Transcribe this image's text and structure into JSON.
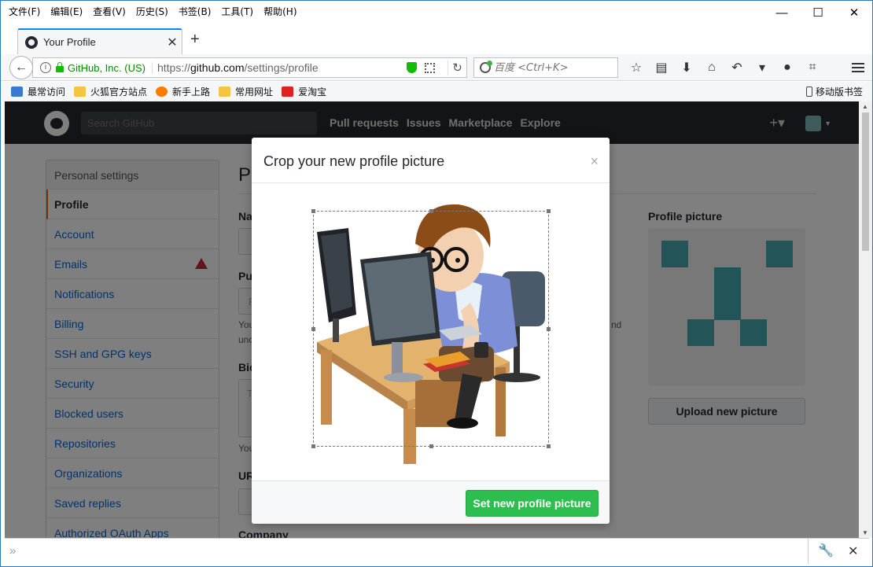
{
  "menubar": {
    "items": [
      "文件(F)",
      "编辑(E)",
      "查看(V)",
      "历史(S)",
      "书签(B)",
      "工具(T)",
      "帮助(H)"
    ]
  },
  "tab": {
    "title": "Your Profile"
  },
  "navbar": {
    "identity": "GitHub, Inc. (US)",
    "url_prefix": "https://",
    "url_domain": "github.com",
    "url_path": "/settings/profile",
    "search_placeholder": "百度 <Ctrl+K>"
  },
  "bookmarks": {
    "items": [
      {
        "label": "最常访问",
        "icon": "most-visited-icon"
      },
      {
        "label": "火狐官方站点",
        "icon": "folder-icon"
      },
      {
        "label": "新手上路",
        "icon": "firefox-icon"
      },
      {
        "label": "常用网址",
        "icon": "folder-icon"
      },
      {
        "label": "爱淘宝",
        "icon": "taobao-icon"
      }
    ],
    "mobile": "移动版书签"
  },
  "github": {
    "search_placeholder": "Search GitHub",
    "nav": [
      "Pull requests",
      "Issues",
      "Marketplace",
      "Explore"
    ]
  },
  "sidebar": {
    "heading": "Personal settings",
    "items": [
      {
        "label": "Profile"
      },
      {
        "label": "Account"
      },
      {
        "label": "Emails"
      },
      {
        "label": "Notifications"
      },
      {
        "label": "Billing"
      },
      {
        "label": "SSH and GPG keys"
      },
      {
        "label": "Security"
      },
      {
        "label": "Blocked users"
      },
      {
        "label": "Repositories"
      },
      {
        "label": "Organizations"
      },
      {
        "label": "Saved replies"
      },
      {
        "label": "Authorized OAuth Apps"
      }
    ]
  },
  "main": {
    "title_partial": "Pu",
    "label_name": "Na",
    "label_public": "Pu",
    "input_partial": "P",
    "note_1": "You",
    "note_2": "unc",
    "note_tail": "nd",
    "label_bio": "Bio",
    "input_bio_partial": "T",
    "note_3": "You",
    "label_url": "UR",
    "label_company": "Company",
    "profile_picture_label": "Profile picture",
    "upload_button": "Upload new picture"
  },
  "modal": {
    "title": "Crop your new profile picture",
    "close": "×",
    "submit": "Set new profile picture"
  },
  "colors": {
    "accent_green": "#2cbe4e",
    "header_bg": "#24292e",
    "identicon": "#47a8b0"
  }
}
